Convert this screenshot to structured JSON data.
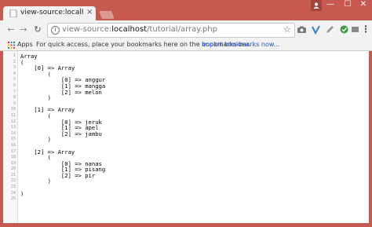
{
  "tab": {
    "title": "view-source:localhost/tu",
    "close": "×"
  },
  "window": {
    "minimize": "—",
    "maximize": "☐",
    "close": "✕"
  },
  "toolbar": {
    "back": "←",
    "forward": "→",
    "reload": "↻",
    "url_prefix": "view-source:",
    "url_host": "localhost",
    "url_path": "/tutorial/array.php",
    "star": "☆",
    "menu": "⋮"
  },
  "bookmarks": {
    "apps": "Apps",
    "hint": "For quick access, place your bookmarks here on the bookmarks bar.",
    "import": "Import bookmarks now..."
  },
  "source": {
    "lines": [
      {
        "n": "1",
        "text": "Array"
      },
      {
        "n": "2",
        "text": "("
      },
      {
        "n": "3",
        "text": "    [0] => Array"
      },
      {
        "n": "4",
        "text": "        ("
      },
      {
        "n": "5",
        "text": "            [0] => anggur"
      },
      {
        "n": "6",
        "text": "            [1] => mangga"
      },
      {
        "n": "7",
        "text": "            [2] => melon"
      },
      {
        "n": "8",
        "text": "        )"
      },
      {
        "n": "9",
        "text": ""
      },
      {
        "n": "10",
        "text": "    [1] => Array"
      },
      {
        "n": "11",
        "text": "        ("
      },
      {
        "n": "12",
        "text": "            [0] => jeruk"
      },
      {
        "n": "13",
        "text": "            [1] => apel"
      },
      {
        "n": "14",
        "text": "            [2] => jambu"
      },
      {
        "n": "15",
        "text": "        )"
      },
      {
        "n": "16",
        "text": ""
      },
      {
        "n": "17",
        "text": "    [2] => Array"
      },
      {
        "n": "18",
        "text": "        ("
      },
      {
        "n": "19",
        "text": "            [0] => nanas"
      },
      {
        "n": "20",
        "text": "            [1] => pisang"
      },
      {
        "n": "21",
        "text": "            [2] => pir"
      },
      {
        "n": "22",
        "text": "        )"
      },
      {
        "n": "23",
        "text": ""
      },
      {
        "n": "24",
        "text": ")"
      },
      {
        "n": "25",
        "text": ""
      }
    ]
  },
  "colors": {
    "frame": "#c75a50",
    "toolbar": "#f2f2f2",
    "link": "#1a56c6"
  }
}
